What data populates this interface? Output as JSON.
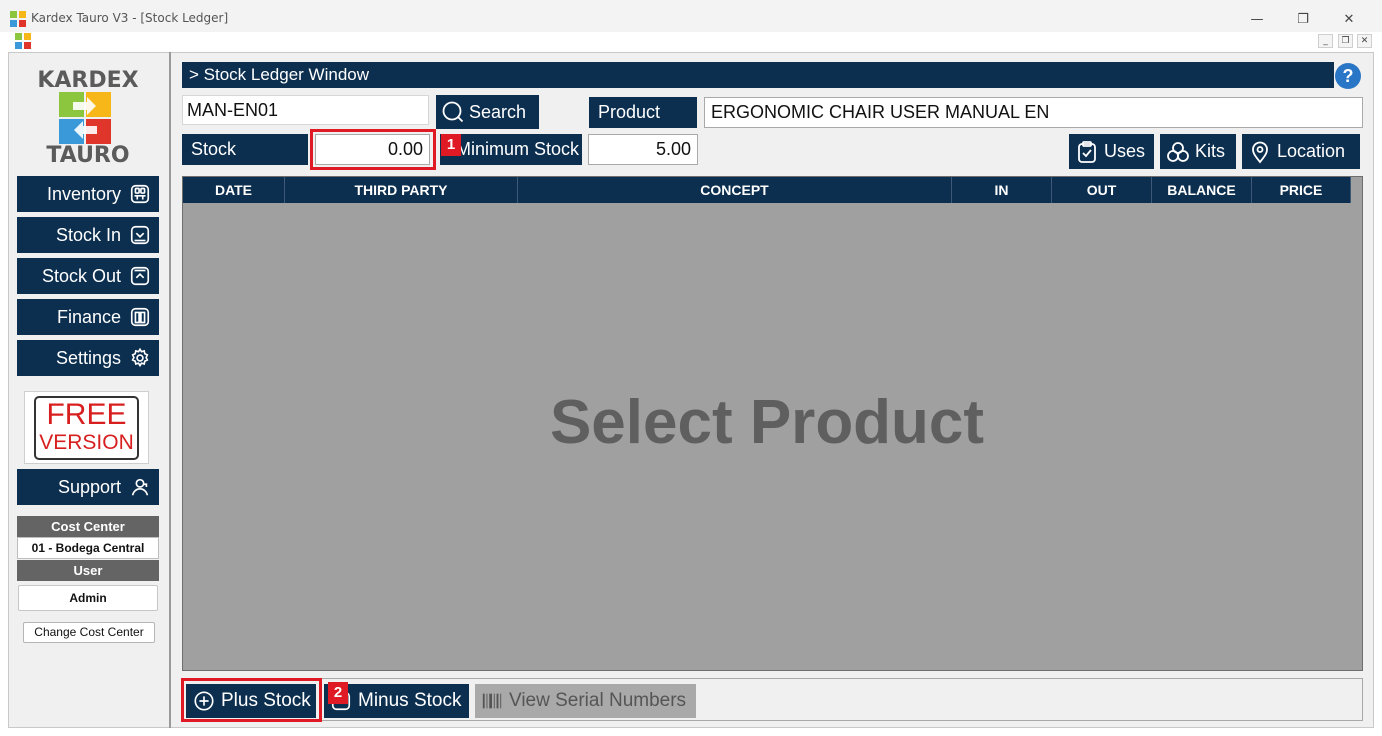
{
  "window": {
    "title": "Kardex Tauro V3 - [Stock Ledger]",
    "minimize": "—",
    "restore": "❐",
    "close": "✕",
    "mdi_minimize": "_",
    "mdi_restore": "❐",
    "mdi_close": "✕"
  },
  "logo": {
    "top": "KARDEX",
    "bottom": "TAURO"
  },
  "sidebar": {
    "items": [
      {
        "label": "Inventory",
        "icon": "inventory-icon"
      },
      {
        "label": "Stock In",
        "icon": "stock-in-icon"
      },
      {
        "label": "Stock Out",
        "icon": "stock-out-icon"
      },
      {
        "label": "Finance",
        "icon": "book-icon"
      },
      {
        "label": "Settings",
        "icon": "gear-icon"
      }
    ],
    "free_line1": "FREE",
    "free_line2": "VERSION",
    "support": "Support",
    "cost_center_label": "Cost Center",
    "cost_center_value": "01 - Bodega Central",
    "user_label": "User",
    "user_value": "Admin",
    "change_cost_center": "Change Cost Center"
  },
  "main": {
    "header": "> Stock Ledger Window",
    "help": "?",
    "product_code": "MAN-EN01",
    "search_label": "Search",
    "product_label": "Product",
    "product_name": "ERGONOMIC CHAIR USER MANUAL EN",
    "stock_label": "Stock",
    "stock_value": "0.00",
    "minimum_stock_label": "Minimum Stock",
    "minimum_stock_value": "5.00",
    "uses_label": "Uses",
    "kits_label": "Kits",
    "location_label": "Location",
    "columns": [
      "DATE",
      "THIRD PARTY",
      "CONCEPT",
      "IN",
      "OUT",
      "BALANCE",
      "PRICE"
    ],
    "empty_message": "Select Product",
    "plus_stock": "Plus Stock",
    "minus_stock": "Minus Stock",
    "view_serials": "View Serial Numbers"
  },
  "annotations": {
    "badge1": "1",
    "badge2": "2"
  },
  "colors": {
    "navy": "#0d2f4f",
    "highlight": "#e01a24",
    "free_red": "#d81f1f",
    "help_blue": "#2a76c6"
  }
}
